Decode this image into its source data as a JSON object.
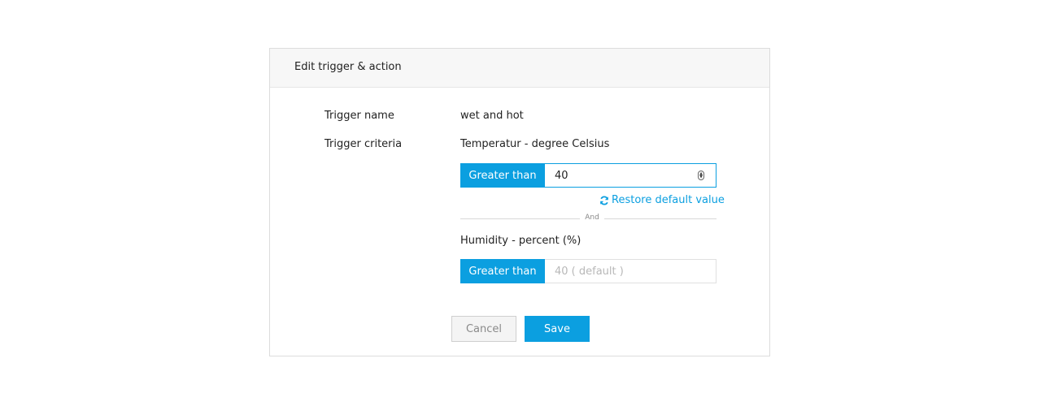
{
  "dialog": {
    "title": "Edit trigger & action"
  },
  "trigger_name": {
    "label": "Trigger name",
    "value": "wet and hot"
  },
  "trigger_criteria": {
    "label": "Trigger criteria",
    "criteria": [
      {
        "sensor": "Temperatur - degree Celsius",
        "operator": "Greater than",
        "value": "40",
        "placeholder": ""
      },
      {
        "sensor": "Humidity - percent (%)",
        "operator": "Greater than",
        "value": "",
        "placeholder": "40 ( default )"
      }
    ],
    "restore_label": "Restore default value",
    "joiner": "And"
  },
  "actions": {
    "cancel_label": "Cancel",
    "save_label": "Save"
  },
  "colors": {
    "accent": "#0b9fe0",
    "header_bg": "#f7f7f7",
    "border": "#dcdcdc"
  },
  "icons": {
    "restore": "refresh-icon",
    "spinner": "number-spinner-icon"
  }
}
